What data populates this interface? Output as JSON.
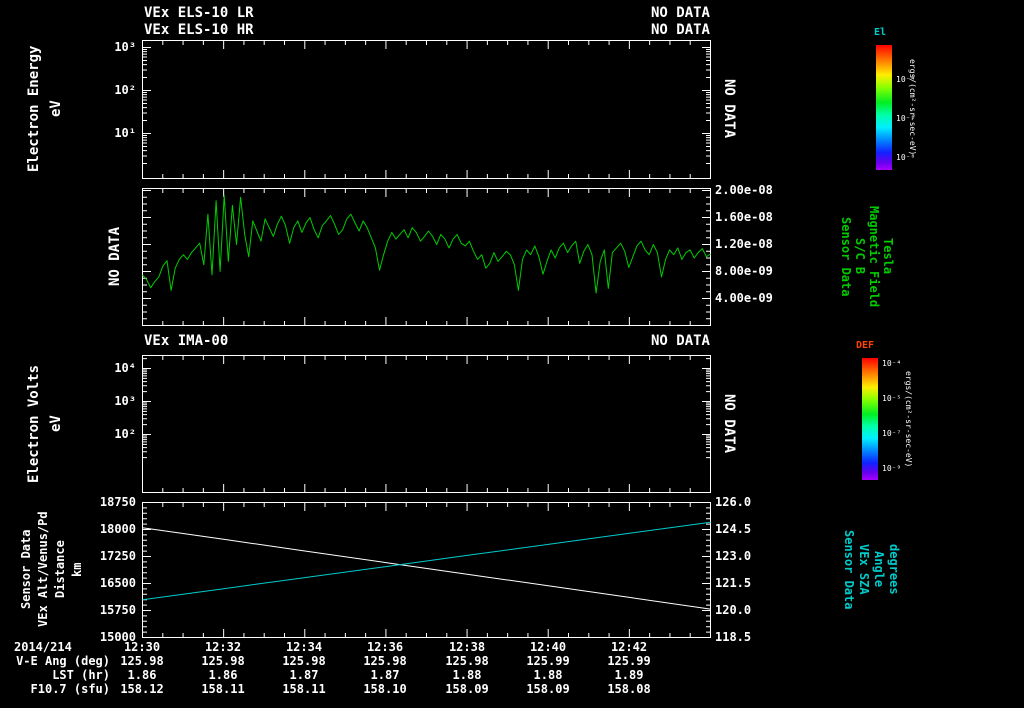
{
  "ui": {
    "colors": {
      "background": "#000000",
      "axis_text": "#ffffff",
      "mag_field_green": "#00cc00",
      "sza_cyan": "#00cccc",
      "el_label": "#00cccc",
      "def_label": "#ff4400"
    },
    "panel1": {
      "title_lr": "VEx ELS-10 LR",
      "status_lr": "NO DATA",
      "title_hr": "VEx ELS-10 HR",
      "status_hr": "NO DATA",
      "ylabel": "Electron Energy",
      "yunit": "eV",
      "yticks": [
        "10³",
        "10²",
        "10¹"
      ],
      "right_label": "NO DATA",
      "colorbar": {
        "title": "El",
        "ticks": [
          "10⁻⁴",
          "10⁻⁶",
          "10⁻⁸"
        ],
        "unit": "ergs/(cm²-sr-sec-eV)"
      }
    },
    "panel2": {
      "left_label": "NO DATA",
      "yticks": [
        "2.00e-08",
        "1.60e-08",
        "1.20e-08",
        "8.00e-09",
        "4.00e-09"
      ],
      "right_labels": [
        "Sensor Data",
        "S/C B",
        "Magnetic Field",
        "Tesla"
      ]
    },
    "panel3": {
      "title": "VEx IMA-00",
      "status": "NO DATA",
      "ylabel": "Electron Volts",
      "yunit": "eV",
      "yticks": [
        "10⁴",
        "10³",
        "10²"
      ],
      "right_label": "NO DATA",
      "colorbar": {
        "title": "DEF",
        "ticks": [
          "10⁻⁴",
          "10⁻⁵",
          "10⁻⁷",
          "10⁻⁹"
        ],
        "unit": "ergs/(cm²-sr-sec-eV)"
      }
    },
    "panel4": {
      "left_labels": [
        "Sensor Data",
        "VEx Alt/Venus/Pd",
        "Distance",
        "km"
      ],
      "left_ticks": [
        "18750",
        "18000",
        "17250",
        "16500",
        "15750",
        "15000"
      ],
      "right_ticks": [
        "126.0",
        "124.5",
        "123.0",
        "121.5",
        "120.0",
        "118.5"
      ],
      "right_labels": [
        "Sensor Data",
        "VEx SZA",
        "Angle",
        "degrees"
      ]
    },
    "xaxis": {
      "date": "2014/214",
      "ticks": [
        "12:30",
        "12:32",
        "12:34",
        "12:36",
        "12:38",
        "12:40",
        "12:42"
      ]
    },
    "table": {
      "rows": [
        {
          "label": "V-E Ang (deg)",
          "values": [
            "125.98",
            "125.98",
            "125.98",
            "125.98",
            "125.98",
            "125.99",
            "125.99"
          ]
        },
        {
          "label": "LST (hr)",
          "values": [
            "1.86",
            "1.86",
            "1.87",
            "1.87",
            "1.88",
            "1.88",
            "1.89"
          ]
        },
        {
          "label": "F10.7 (sfu)",
          "values": [
            "158.12",
            "158.11",
            "158.11",
            "158.10",
            "158.09",
            "158.09",
            "158.08"
          ]
        }
      ]
    }
  },
  "chart_data": [
    {
      "panel": "VEx ELS-10",
      "type": "heatmap",
      "title": "VEx ELS-10 LR / VEx ELS-10 HR",
      "status": "NO DATA",
      "ylabel": "Electron Energy (eV)",
      "yscale": "log",
      "yticks": [
        1000,
        100,
        10
      ],
      "colorbar": {
        "label": "El",
        "unit": "ergs/(cm2-sr-sec-eV)",
        "ticks": [
          0.0001,
          1e-06,
          1e-08
        ]
      },
      "values": []
    },
    {
      "panel": "S/C B Magnetic Field",
      "type": "line",
      "name": "Sensor Data S/C B Magnetic Field",
      "unit": "Tesla",
      "x_range": [
        "12:30",
        "12:44"
      ],
      "ylim": [
        0,
        2.03e-08
      ],
      "yticks": [
        2e-08,
        1.6e-08,
        1.2e-08,
        8e-09,
        4e-09
      ],
      "values_unit": "1e-9 Tesla",
      "values_nT": [
        7.5,
        6.8,
        5.6,
        6.5,
        7.2,
        8.8,
        9.6,
        5.2,
        8.5,
        9.8,
        10.5,
        9.8,
        10.8,
        11.5,
        12.2,
        9.0,
        16.5,
        7.5,
        18.5,
        8.0,
        19.3,
        9.5,
        17.8,
        12.0,
        19.0,
        13.5,
        10.2,
        15.5,
        14.0,
        12.5,
        15.8,
        14.5,
        13.2,
        15.0,
        16.2,
        14.8,
        12.2,
        14.5,
        15.5,
        13.8,
        15.2,
        16.0,
        14.2,
        13.0,
        14.8,
        15.5,
        16.3,
        15.0,
        13.5,
        14.2,
        15.8,
        16.5,
        15.2,
        14.0,
        15.5,
        14.5,
        13.0,
        11.5,
        8.2,
        10.5,
        12.5,
        13.8,
        12.8,
        13.5,
        14.2,
        13.0,
        14.5,
        13.8,
        12.5,
        13.2,
        14.0,
        13.2,
        12.0,
        13.5,
        12.8,
        11.5,
        12.8,
        13.5,
        12.2,
        11.8,
        12.5,
        11.0,
        9.8,
        10.5,
        8.5,
        9.2,
        10.8,
        9.5,
        10.2,
        11.0,
        10.5,
        9.0,
        5.2,
        9.8,
        11.2,
        10.5,
        11.8,
        10.2,
        7.6,
        9.5,
        11.2,
        10.0,
        11.5,
        12.2,
        10.8,
        11.8,
        12.5,
        9.2,
        11.0,
        12.0,
        10.5,
        4.8,
        9.5,
        11.2,
        5.5,
        10.8,
        11.5,
        12.2,
        11.0,
        8.6,
        10.2,
        11.8,
        12.5,
        11.2,
        10.5,
        12.0,
        10.8,
        7.2,
        9.8,
        11.2,
        10.5,
        11.5,
        9.8,
        10.8,
        11.2,
        10.0,
        10.8,
        11.4,
        10.2,
        10.6
      ]
    },
    {
      "panel": "VEx IMA-00",
      "type": "heatmap",
      "title": "VEx IMA-00",
      "status": "NO DATA",
      "ylabel": "Electron Volts (eV)",
      "yscale": "log",
      "yticks": [
        10000,
        1000,
        100
      ],
      "colorbar": {
        "label": "DEF",
        "unit": "ergs/(cm2-sr-sec-eV)",
        "ticks": [
          0.0001,
          1e-05,
          1e-07,
          1e-09
        ]
      },
      "values": []
    },
    {
      "panel": "Ephemeris",
      "type": "line",
      "x_ticks": [
        "12:30",
        "12:32",
        "12:34",
        "12:36",
        "12:38",
        "12:40",
        "12:42"
      ],
      "x_range": [
        "12:30",
        "12:44"
      ],
      "series": [
        {
          "name": "VEx Alt/Venus/Pd Distance",
          "unit": "km",
          "axis": "left",
          "ylim": [
            15000,
            18750
          ],
          "yticks": [
            18750,
            18000,
            17250,
            16500,
            15750,
            15000
          ],
          "values": [
            18050,
            17727,
            17404,
            17081,
            16759,
            16436,
            16113,
            15790
          ]
        },
        {
          "name": "VEx SZA Angle",
          "unit": "degrees",
          "axis": "right",
          "ylim": [
            118.5,
            126.0
          ],
          "yticks": [
            126.0,
            124.5,
            123.0,
            121.5,
            120.0,
            118.5
          ],
          "values": [
            120.6,
            121.21,
            121.83,
            122.44,
            123.06,
            123.67,
            124.29,
            124.9
          ]
        }
      ]
    }
  ]
}
